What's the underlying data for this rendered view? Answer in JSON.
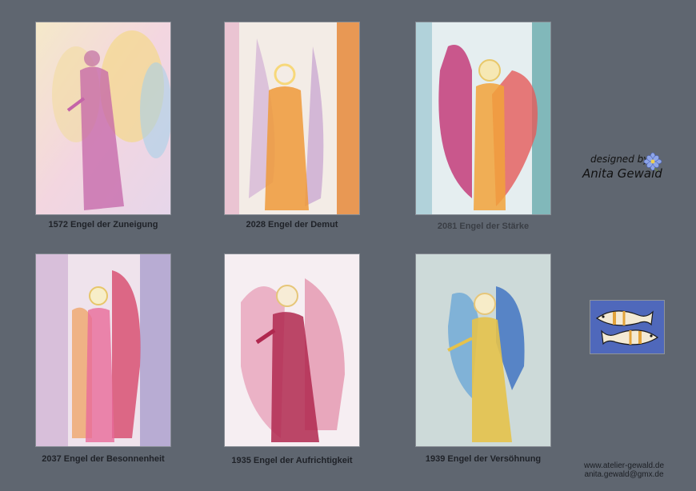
{
  "cards": [
    {
      "caption": "1572 Engel der Zuneigung"
    },
    {
      "caption": "2028 Engel der Demut"
    },
    {
      "caption": "2081 Engel der Stärke"
    },
    {
      "caption": "2037 Engel der Besonnenheit"
    },
    {
      "caption": "1935 Engel der Aufrichtigkeit"
    },
    {
      "caption": "1939 Engel der Versöhnung"
    }
  ],
  "brand": {
    "designed_by": "designed by",
    "name": "Anita Gewald"
  },
  "contact": {
    "website": "www.atelier-gewald.de",
    "email": "anita.gewald@gmx.de"
  },
  "colors": {
    "background": "#5f6670"
  }
}
